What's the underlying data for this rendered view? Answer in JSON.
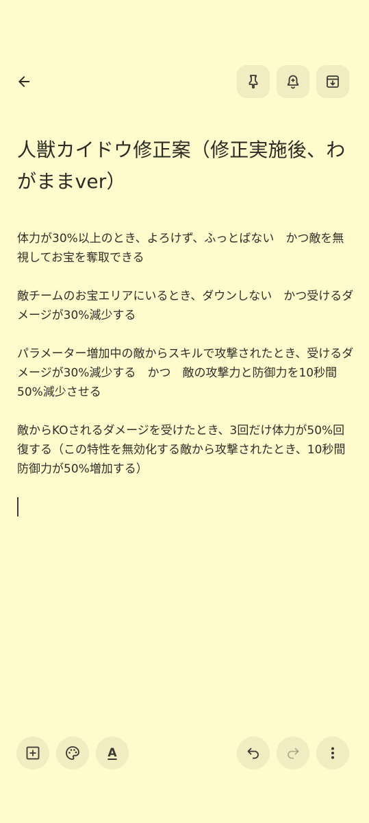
{
  "note": {
    "title": "人獣カイドウ修正案（修正実施後、わがままver）",
    "paragraphs": [
      "体力が30%以上のとき、よろけず、ふっとばない　かつ敵を無視してお宝を奪取できる",
      "敵チームのお宝エリアにいるとき、ダウンしない　かつ受けるダメージが30%減少する",
      "パラメーター増加中の敵からスキルで攻撃されたとき、受けるダメージが30%減少する　かつ　敵の攻撃力と防御力を10秒間50%減少させる",
      "敵からKOされるダメージを受けたとき、3回だけ体力が50%回復する（この特性を無効化する敵から攻撃されたとき、10秒間防御力が50%増加する）"
    ]
  },
  "toolbar": {
    "text_format_label": "A"
  },
  "icons": {
    "back": "arrow-left-icon",
    "pin": "pin-icon",
    "reminder": "bell-plus-icon",
    "archive": "archive-icon",
    "add": "add-box-icon",
    "palette": "palette-icon",
    "text_format": "text-format-icon",
    "undo": "undo-icon",
    "redo": "redo-icon",
    "more": "more-vert-icon"
  },
  "colors": {
    "background": "#fffbcd",
    "button_bg": "#f1ecc2",
    "text": "#2b2b24"
  }
}
